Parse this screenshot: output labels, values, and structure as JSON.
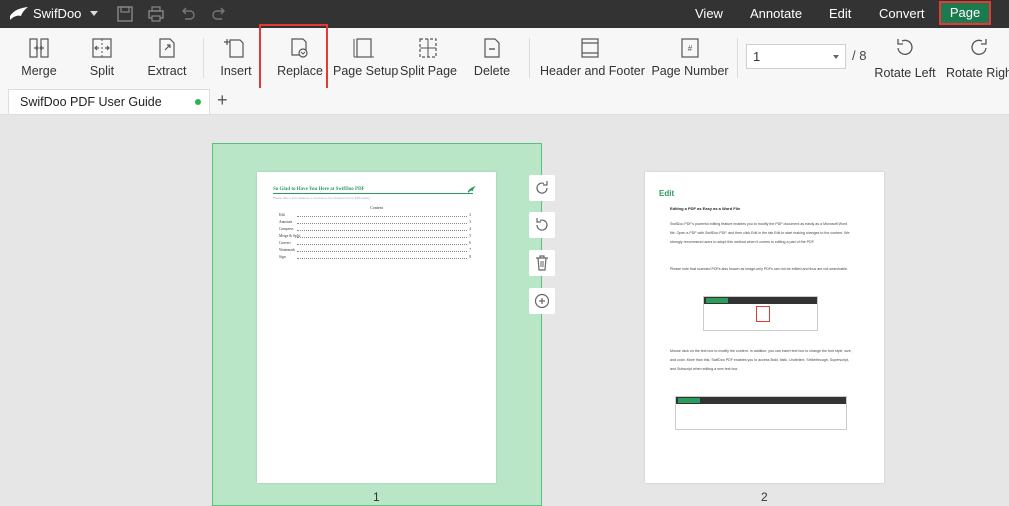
{
  "app": {
    "name": "SwifDoo"
  },
  "menu": {
    "items": [
      "View",
      "Annotate",
      "Edit",
      "Convert"
    ],
    "active": "Page"
  },
  "ribbon": {
    "merge": "Merge",
    "split": "Split",
    "extract": "Extract",
    "insert": "Insert",
    "replace": "Replace",
    "page_setup": "Page Setup",
    "split_page": "Split Page",
    "delete": "Delete",
    "header_footer": "Header and Footer",
    "page_number": "Page Number",
    "page_value": "1",
    "page_total": "/ 8",
    "rotate_left": "Rotate Left",
    "rotate_right": "Rotate Right"
  },
  "tabs": {
    "doc_name": "SwifDoo PDF User Guide",
    "add": "+"
  },
  "pages": [
    {
      "number": "1",
      "title": "So Glad to Have You Here at SwifDoo PDF",
      "subtitle": "Please take a few minutes to learn how the features below Efficiently",
      "contents_heading": "Content",
      "toc": [
        {
          "label": "Edit",
          "page": "2"
        },
        {
          "label": "Annotate",
          "page": "3"
        },
        {
          "label": "Compress",
          "page": "4"
        },
        {
          "label": "Merge & Split",
          "page": "5"
        },
        {
          "label": "Convert",
          "page": "6"
        },
        {
          "label": "Watermark",
          "page": "7"
        },
        {
          "label": "Sign",
          "page": "8"
        }
      ]
    },
    {
      "number": "2",
      "heading": "Edit",
      "subheading": "Editing a PDF as Easy as a Word File",
      "para1": "SwifDoo PDF's powerful editing feature enables you to modify the PDF document as easily as a Microsoft Word file. Open a PDF with SwifDoo PDF, and then click Edit in the tab Edit to start making changes to the content. We strongly recommend users to adopt this method when it comes to editing a part of the PDF.",
      "para2": "Please note that scanned PDFs also known as image-only PDFs can not be edited and thus are not searchable.",
      "para3": "Mouse click on the text box to modify the content. In addition, you can insert text box to change the font style, size, and color. More than this, SwifDoo PDF enables you to access Bold, Italic, Underline, Strikethrough, Superscript, and Subscript when editing a new text box."
    }
  ],
  "colors": {
    "accent": "#1c7a4f",
    "highlight": "#e53935",
    "selection": "#b9e6c6"
  }
}
